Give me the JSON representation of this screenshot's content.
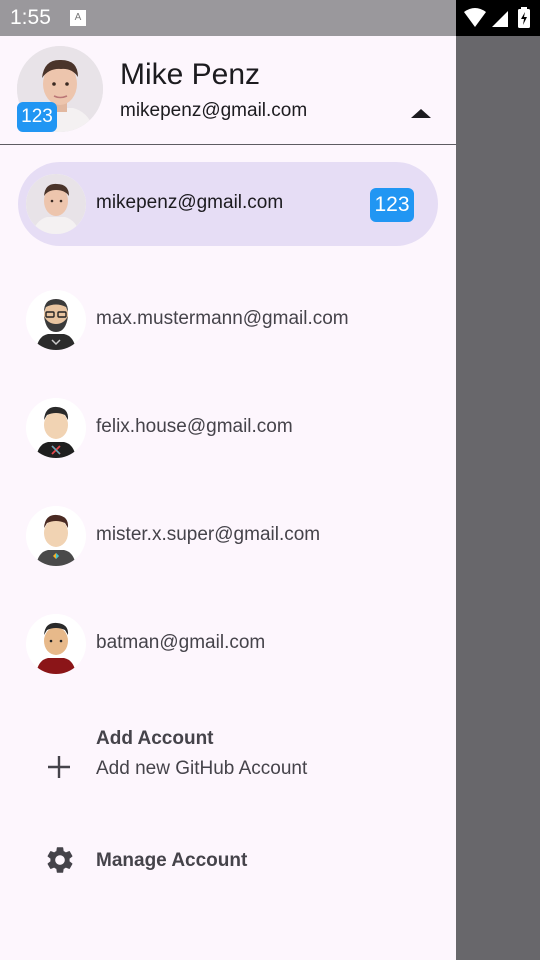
{
  "status_bar": {
    "time": "1:55",
    "notification_icon": "A"
  },
  "header": {
    "name": "Mike Penz",
    "email": "mikepenz@gmail.com",
    "badge": "123"
  },
  "accounts": [
    {
      "email": "mikepenz@gmail.com",
      "badge": "123",
      "selected": true
    },
    {
      "email": "max.mustermann@gmail.com"
    },
    {
      "email": "felix.house@gmail.com"
    },
    {
      "email": "mister.x.super@gmail.com"
    },
    {
      "email": "batman@gmail.com"
    }
  ],
  "add_account": {
    "title": "Add Account",
    "subtitle": "Add new GitHub Account",
    "icon": "plus-icon"
  },
  "manage_account": {
    "label": "Manage Account",
    "icon": "gear-icon"
  },
  "colors": {
    "drawer_bg": "#fdf6fd",
    "selected_pill": "#e6ddf5",
    "badge_bg": "#2196f3",
    "scrim": "#68676b",
    "status_bar": "#9a989c"
  }
}
